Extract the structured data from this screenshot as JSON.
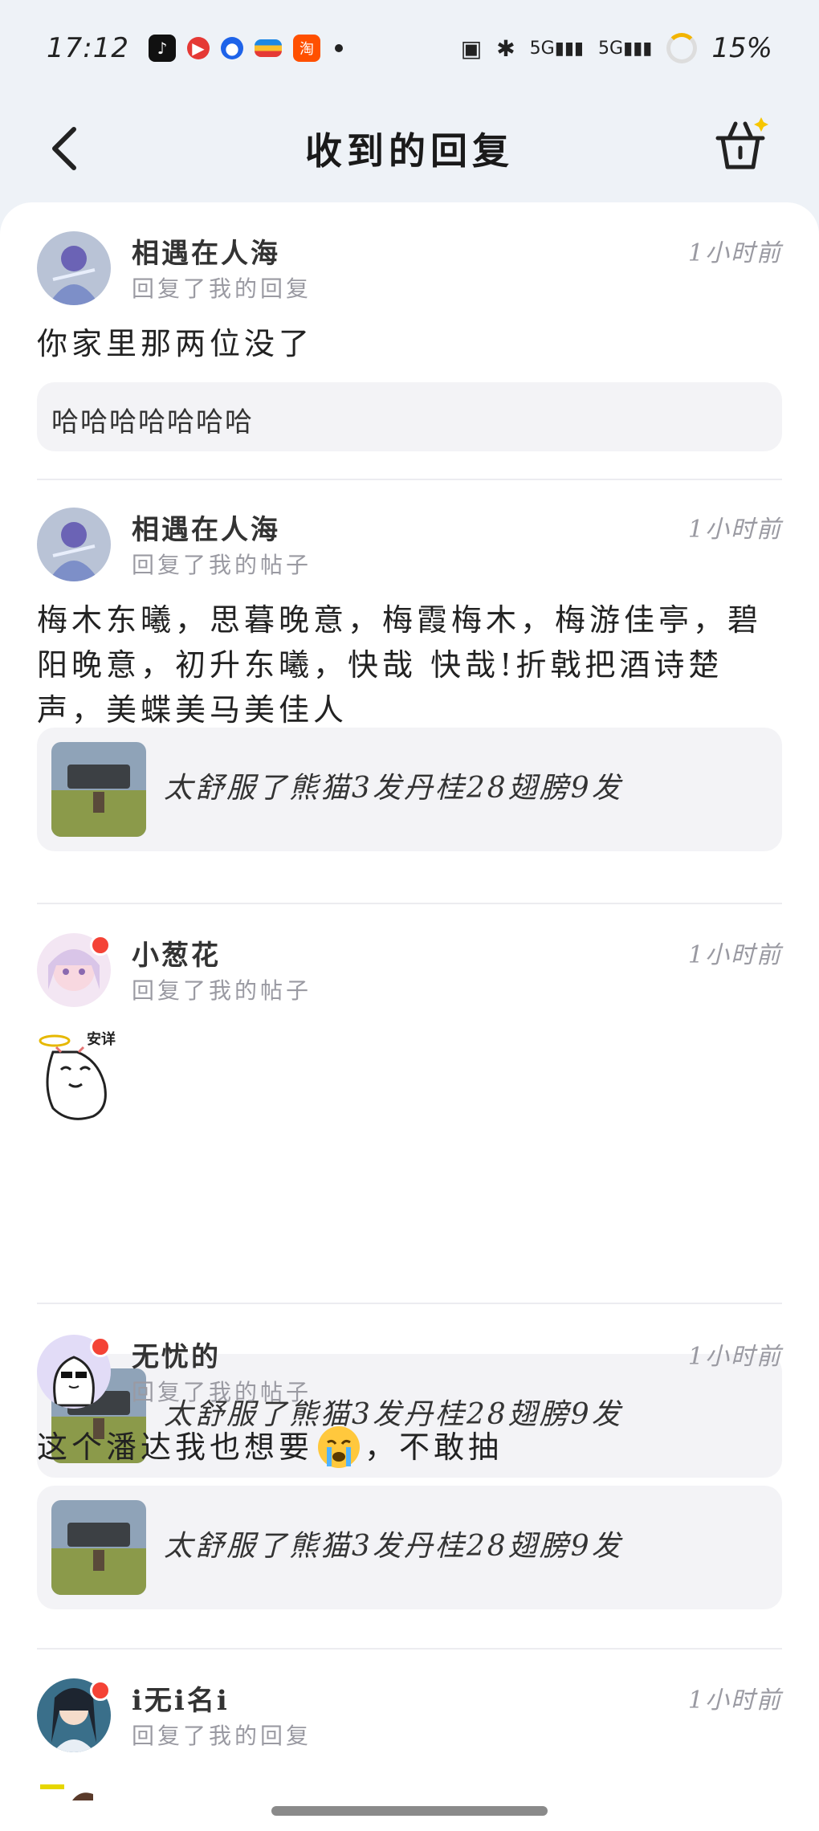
{
  "status_bar": {
    "time": "17:12",
    "network1": "5G",
    "network2": "5G",
    "battery": "15%"
  },
  "header": {
    "title": "收到的回复"
  },
  "replies": [
    {
      "username": "相遇在人海",
      "action": "回复了我的回复",
      "time": "1小时前",
      "content": "你家里那两位没了",
      "quote": "哈哈哈哈哈哈哈"
    },
    {
      "username": "相遇在人海",
      "action": "回复了我的帖子",
      "time": "1小时前",
      "content": "梅木东曦，思暮晚意，梅霞梅木，梅游佳亭，碧阳晚意，初升东曦，快哉 快哉!折戟把酒诗楚声，美蝶美马美佳人",
      "quote": "太舒服了熊猫3发丹桂28翅膀9发"
    },
    {
      "username": "小葱花",
      "action": "回复了我的帖子",
      "time": "1小时前",
      "sticker_text": "安详",
      "quote": "太舒服了熊猫3发丹桂28翅膀9发"
    },
    {
      "username": "无忧的",
      "action": "回复了我的帖子",
      "time": "1小时前",
      "content_before": "这个潘达我也想要",
      "content_after": "，不敢抽",
      "quote": "太舒服了熊猫3发丹桂28翅膀9发"
    },
    {
      "username": "i无i名i",
      "action": "回复了我的回复",
      "time": "1小时前"
    }
  ],
  "colors": {
    "background": "#eef2f7",
    "card": "#ffffff",
    "badge": "#f44336",
    "muted": "#9a9aa2",
    "quote_bg": "#f3f3f6"
  }
}
